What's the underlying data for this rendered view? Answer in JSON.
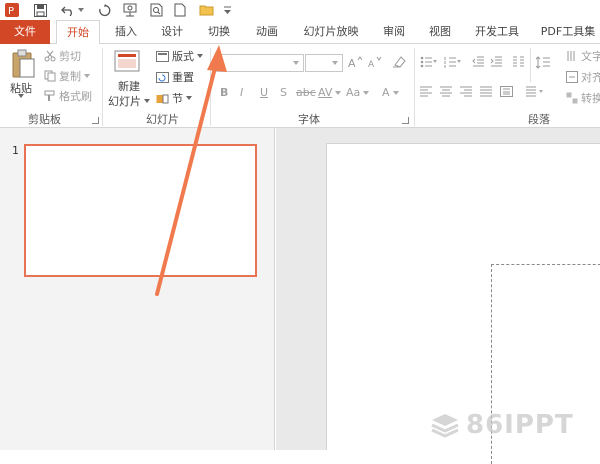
{
  "tabs": {
    "file": "文件",
    "home": "开始",
    "insert": "插入",
    "design": "设计",
    "transitions": "切换",
    "animations": "动画",
    "slideshow": "幻灯片放映",
    "review": "审阅",
    "view": "视图",
    "developer": "开发工具",
    "pdf": "PDF工具集"
  },
  "clipboard": {
    "paste": "粘贴",
    "cut": "剪切",
    "copy": "复制",
    "format_painter": "格式刷",
    "group": "剪贴板"
  },
  "slides_group": {
    "new_slide_line1": "新建",
    "new_slide_line2": "幻灯片",
    "layout": "版式",
    "reset": "重置",
    "section": "节",
    "group": "幻灯片"
  },
  "font_group": {
    "bold": "B",
    "italic": "I",
    "underline": "U",
    "strike": "S",
    "spacing": "AV",
    "case": "Aa",
    "color": "A",
    "group": "字体"
  },
  "paragraph_group": {
    "text_direction": "文字",
    "align_text": "对齐",
    "convert": "转换",
    "group": "段落"
  },
  "thumbnail": {
    "number": "1"
  },
  "watermark": "86IPPT",
  "colors": {
    "accent": "#d24726",
    "arrow": "#f07a4d",
    "thumb_border": "#e87352"
  }
}
